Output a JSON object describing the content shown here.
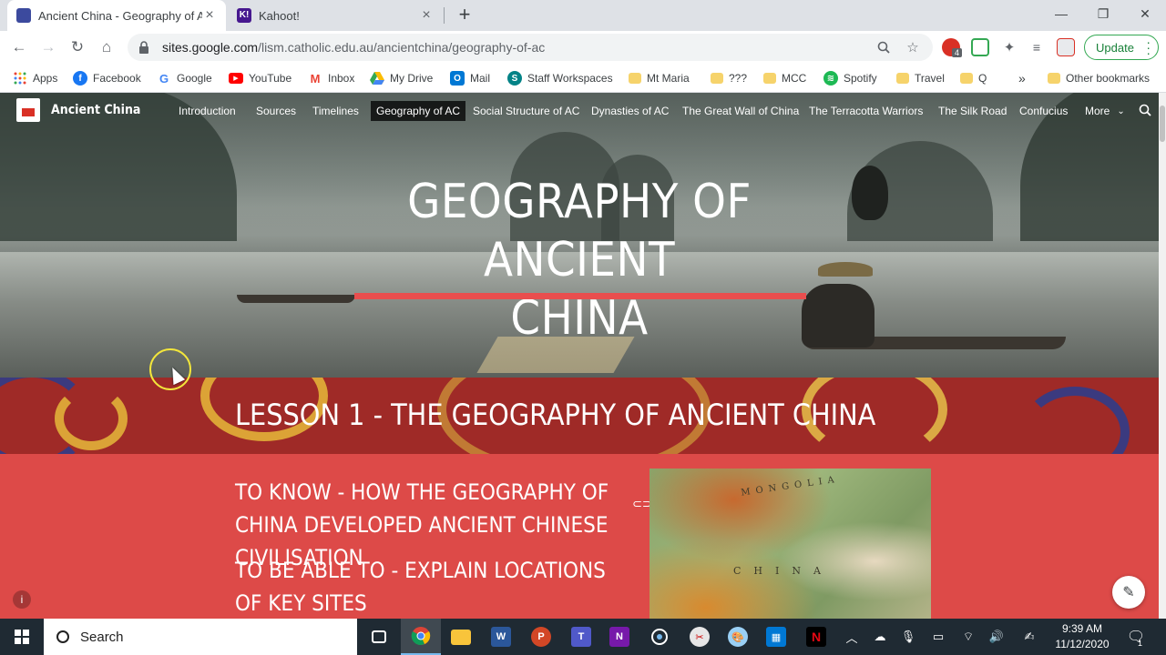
{
  "browser": {
    "tabs": [
      {
        "title": "Ancient China - Geography of AC",
        "active": true
      },
      {
        "title": "Kahoot!",
        "active": false
      }
    ],
    "address": {
      "host": "sites.google.com",
      "path": "/lism.catholic.edu.au/ancientchina/geography-of-ac"
    },
    "update_label": "Update",
    "extension_badge": "4",
    "bookmarks": [
      "Apps",
      "Facebook",
      "Google",
      "YouTube",
      "Inbox",
      "My Drive",
      "Mail",
      "Staff Workspaces",
      "Mt Maria",
      "???",
      "MCC",
      "Spotify",
      "Travel",
      "Q"
    ],
    "bookmarks_overflow": "»",
    "other_bookmarks": "Other bookmarks"
  },
  "site": {
    "title": "Ancient China",
    "nav": [
      "Introduction",
      "Sources",
      "Timelines",
      "Geography of AC",
      "Social Structure of AC",
      "Dynasties of AC",
      "The Great Wall of China",
      "The Terracotta Warriors",
      "The Silk Road",
      "Confucius"
    ],
    "nav_active": "Geography of AC",
    "more_label": "More",
    "hero_title_line1": "GEOGRAPHY OF ANCIENT",
    "hero_title_line2": "CHINA",
    "lesson_title": "LESSON 1 - THE GEOGRAPHY OF ANCIENT CHINA",
    "objective_know": "TO KNOW - HOW THE GEOGRAPHY OF CHINA DEVELOPED ANCIENT CHINESE CIVILISATION",
    "objective_able": "TO BE ABLE TO - EXPLAIN LOCATIONS OF KEY SITES",
    "map_labels": {
      "mongolia": "MONGOLIA",
      "china": "CHINA"
    }
  },
  "taskbar": {
    "search_placeholder": "Search",
    "time": "9:39 AM",
    "date": "11/12/2020",
    "notification_count": "1"
  },
  "colors": {
    "accent_red": "#dd4a48",
    "hero_underline": "#e94e4e",
    "banner_red": "#9f2a27",
    "update_green": "#188038"
  }
}
